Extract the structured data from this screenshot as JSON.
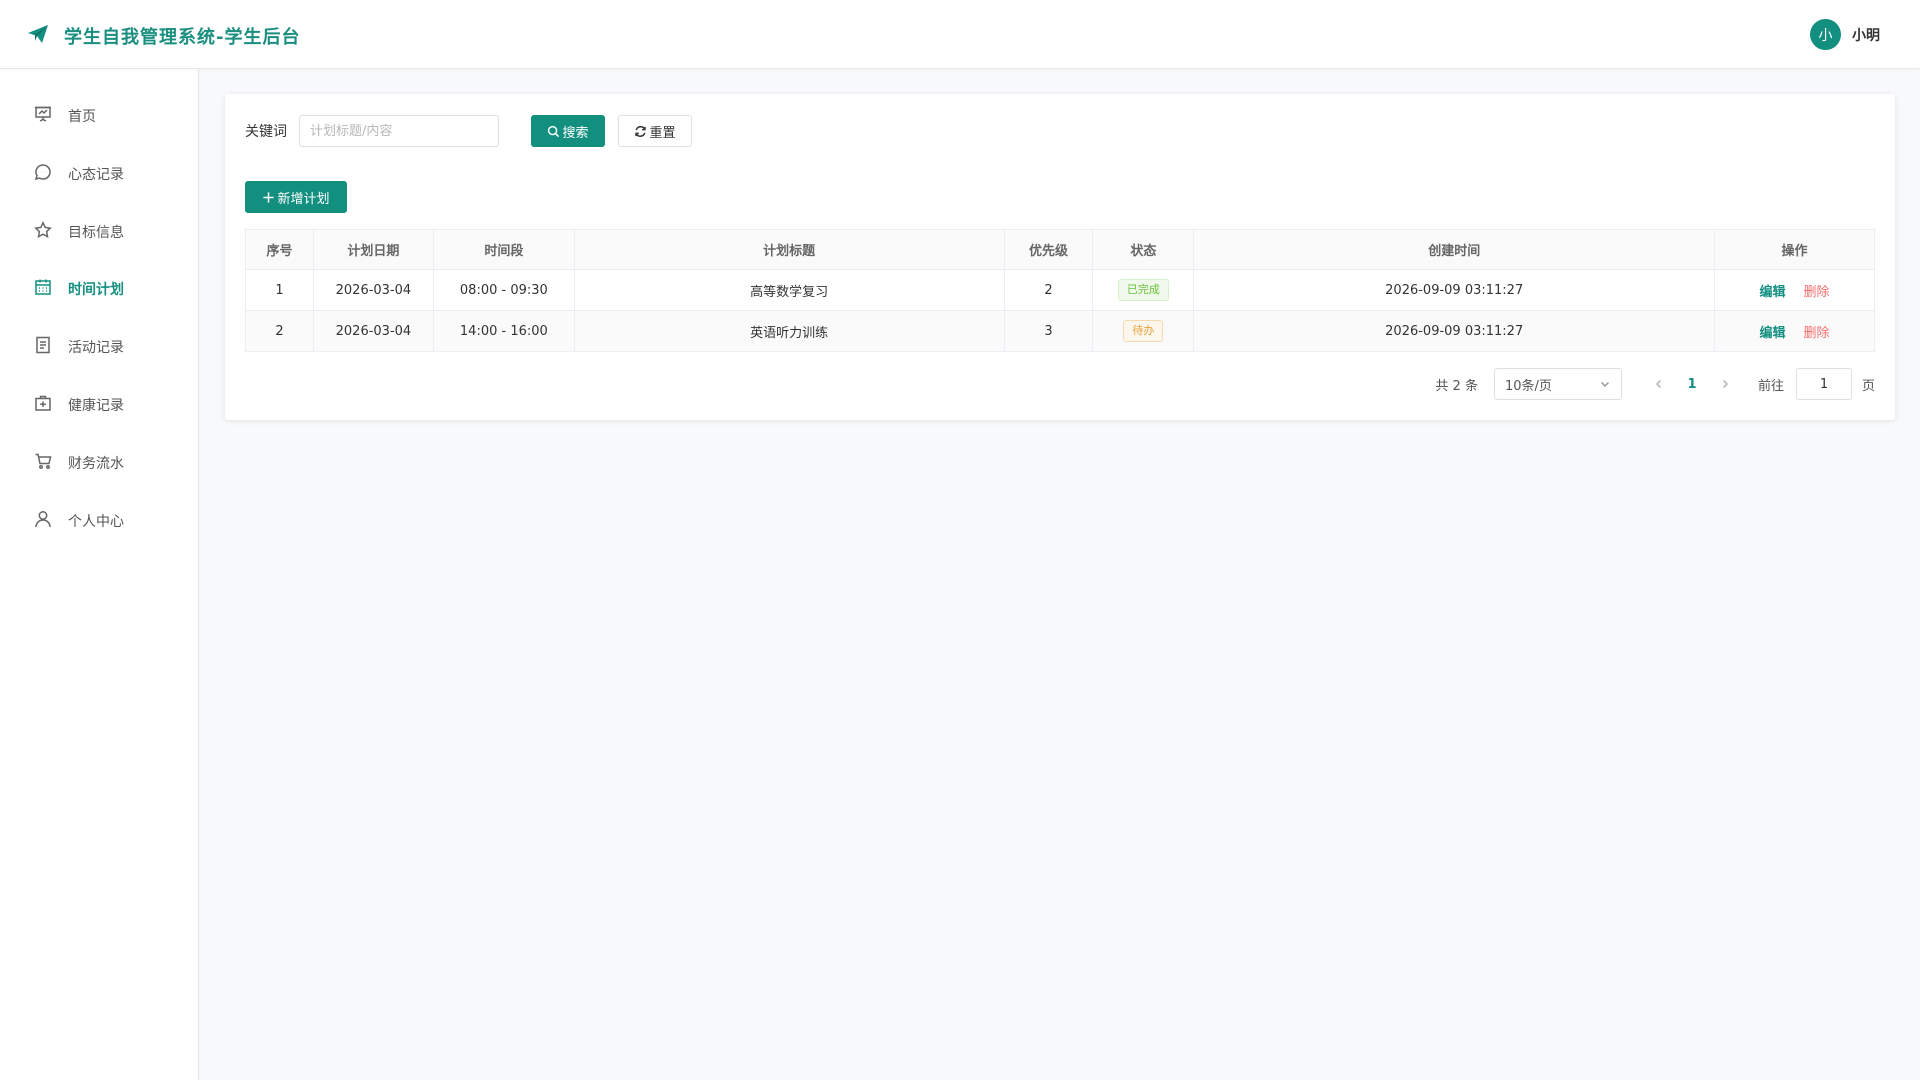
{
  "header": {
    "title": "学生自我管理系统-学生后台",
    "logo_icon": "paper-plane-icon",
    "avatar_text": "小",
    "username": "小明"
  },
  "colors": {
    "accent": "#138f80",
    "success": "#67c23a",
    "warning": "#e6a23c",
    "danger": "#f56c6c"
  },
  "sidebar": {
    "items": [
      {
        "label": "首页",
        "icon": "presentation-icon",
        "active": false
      },
      {
        "label": "心态记录",
        "icon": "chat-bubble-icon",
        "active": false
      },
      {
        "label": "目标信息",
        "icon": "star-icon",
        "active": false
      },
      {
        "label": "时间计划",
        "icon": "calendar-icon",
        "active": true
      },
      {
        "label": "活动记录",
        "icon": "document-icon",
        "active": false
      },
      {
        "label": "健康记录",
        "icon": "first-aid-icon",
        "active": false
      },
      {
        "label": "财务流水",
        "icon": "cart-icon",
        "active": false
      },
      {
        "label": "个人中心",
        "icon": "user-icon",
        "active": false
      }
    ]
  },
  "search": {
    "label": "关键词",
    "placeholder": "计划标题/内容",
    "value": "",
    "search_button": "搜索",
    "reset_button": "重置"
  },
  "toolbar": {
    "add_button": "新增计划"
  },
  "table": {
    "columns": [
      "序号",
      "计划日期",
      "时间段",
      "计划标题",
      "优先级",
      "状态",
      "创建时间",
      "操作"
    ],
    "rows": [
      {
        "index": "1",
        "date": "2026-03-04",
        "time_range": "08:00 - 09:30",
        "title": "高等数学复习",
        "priority": "2",
        "status": "已完成",
        "status_type": "success",
        "created": "2026-09-09 03:11:27"
      },
      {
        "index": "2",
        "date": "2026-03-04",
        "time_range": "14:00 - 16:00",
        "title": "英语听力训练",
        "priority": "3",
        "status": "待办",
        "status_type": "warning",
        "created": "2026-09-09 03:11:27"
      }
    ],
    "edit_label": "编辑",
    "delete_label": "删除"
  },
  "pagination": {
    "total_text": "共 2 条",
    "page_size": "10条/页",
    "current_page": "1",
    "goto_label": "前往",
    "goto_value": "1",
    "page_suffix": "页"
  }
}
